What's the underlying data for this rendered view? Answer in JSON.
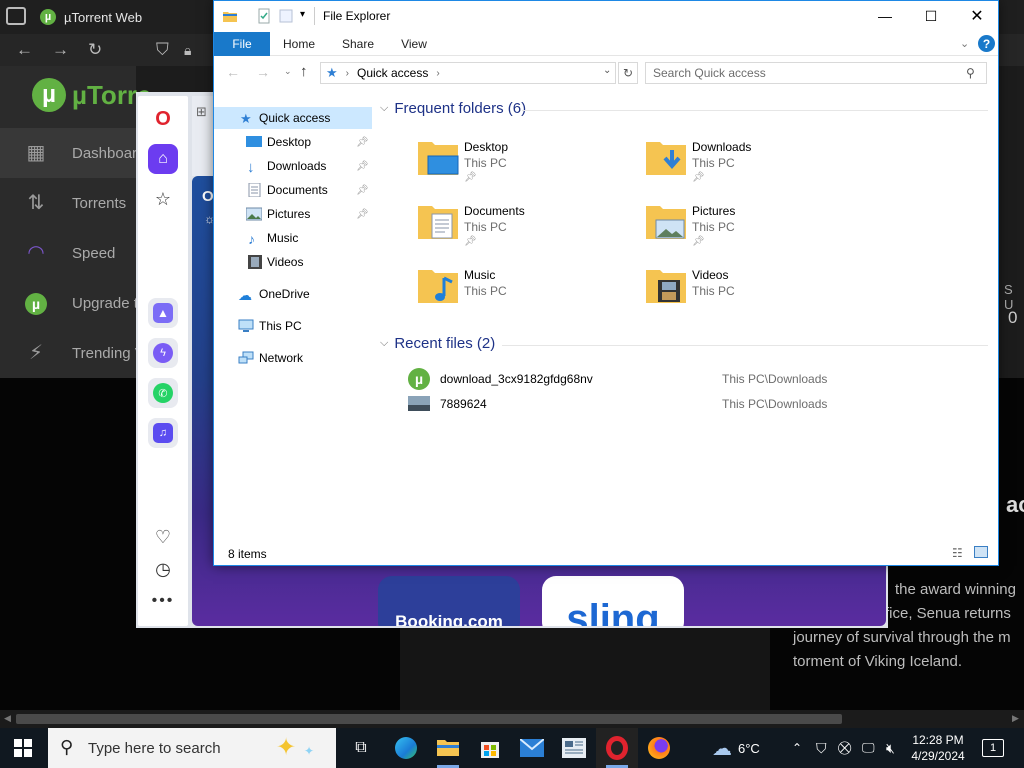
{
  "browser": {
    "tab_title": "µTorrent Web",
    "logo_text": "µTorre",
    "nav": [
      {
        "label": "Dashboar",
        "icon": "dashboard-icon"
      },
      {
        "label": "Torrents",
        "icon": "torrents-icon"
      },
      {
        "label": "Speed",
        "icon": "speed-icon"
      },
      {
        "label": "Upgrade t",
        "icon": "upgrade-icon"
      },
      {
        "label": "Trending V",
        "icon": "trending-icon"
      }
    ],
    "right_strip": {
      "letters": "S U",
      "value": "0"
    },
    "article_heading": "ac",
    "article_lines": [
      "the award winning",
      "fice, Senua returns",
      "journey of survival through the m",
      "torment of Viking Iceland."
    ]
  },
  "opera": {
    "tiles": [
      {
        "label": "Booking.com"
      },
      {
        "label": "sling"
      }
    ],
    "widget_letter": "O"
  },
  "file_explorer": {
    "title": "File Explorer",
    "ribbon_tabs": [
      "File",
      "Home",
      "Share",
      "View"
    ],
    "address": "Quick access",
    "search_placeholder": "Search Quick access",
    "nav": {
      "quick_access": "Quick access",
      "pinned": [
        "Desktop",
        "Downloads",
        "Documents",
        "Pictures"
      ],
      "unpinned": [
        "Music",
        "Videos"
      ],
      "onedrive": "OneDrive",
      "this_pc": "This PC",
      "network": "Network"
    },
    "frequent_header": "Frequent folders (6)",
    "folders": [
      {
        "name": "Desktop",
        "location": "This PC",
        "pinned": true
      },
      {
        "name": "Downloads",
        "location": "This PC",
        "pinned": true
      },
      {
        "name": "Documents",
        "location": "This PC",
        "pinned": true
      },
      {
        "name": "Pictures",
        "location": "This PC",
        "pinned": true
      },
      {
        "name": "Music",
        "location": "This PC",
        "pinned": false
      },
      {
        "name": "Videos",
        "location": "This PC",
        "pinned": false
      }
    ],
    "recent_header": "Recent files (2)",
    "recent": [
      {
        "name": "download_3cx9182gfdg68nv",
        "path": "This PC\\Downloads"
      },
      {
        "name": "7889624",
        "path": "This PC\\Downloads"
      }
    ],
    "status": "8 items"
  },
  "taskbar": {
    "search_placeholder": "Type here to search",
    "weather": "6°C",
    "time": "12:28 PM",
    "date": "4/29/2024",
    "notification_count": "1"
  },
  "colors": {
    "utorrent_green": "#62b143",
    "explorer_accent": "#1979ca",
    "folder_yellow": "#f5c451"
  }
}
